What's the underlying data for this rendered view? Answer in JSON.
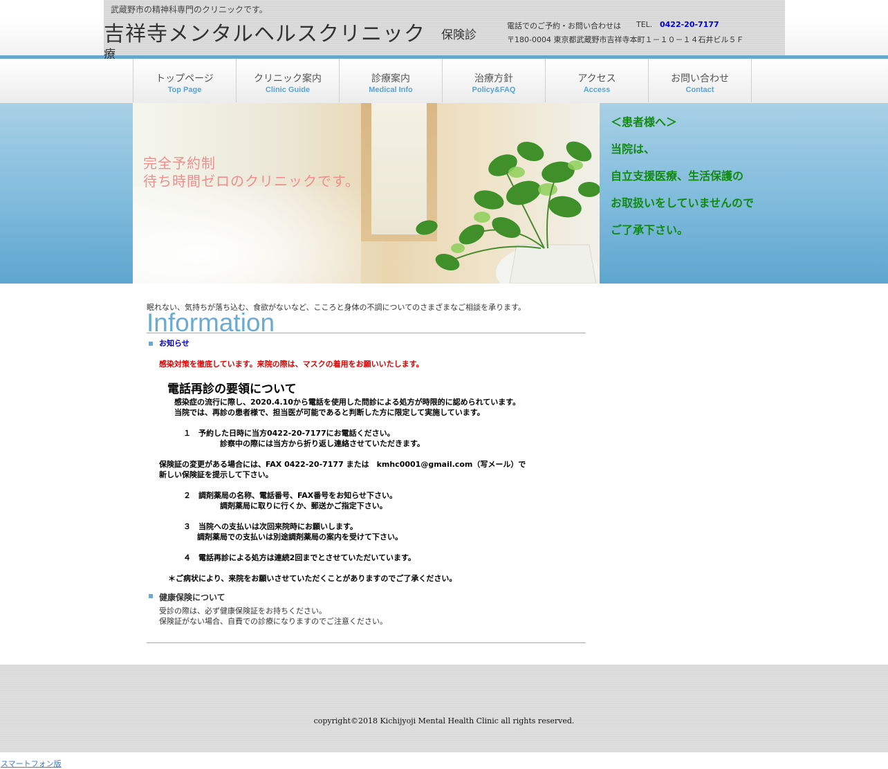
{
  "header": {
    "tagline": "武蔵野市の精神科専門のクリニックです。",
    "site_title": "吉祥寺メンタルヘルスクリニック",
    "insurance_part1": "保険診",
    "insurance_part2": "療",
    "contact_text": "電話でのご予約・お問い合わせは",
    "tel_label": "TEL.",
    "tel_number": "0422-20-7177",
    "address": "〒180-0004 東京都武蔵野市吉祥寺本町１－１０－１４石井ビル５Ｆ"
  },
  "nav": [
    {
      "jp": "トップページ",
      "en": "Top Page"
    },
    {
      "jp": "クリニック案内",
      "en": "Clinic Guide"
    },
    {
      "jp": "診療案内",
      "en": "Medical Info"
    },
    {
      "jp": "治療方針",
      "en": "Policy&FAQ"
    },
    {
      "jp": "アクセス",
      "en": "Access"
    },
    {
      "jp": "お問い合わせ",
      "en": "Contact"
    }
  ],
  "hero": {
    "line1": "完全予約制",
    "line2": "待ち時間ゼロのクリニックです。"
  },
  "notice": [
    "＜患者様へ＞",
    "当院は、",
    "自立支援医療、生活保護の",
    "お取扱いをしていませんので",
    "ご了承下さい。"
  ],
  "main": {
    "intro": "眠れない、気持ちが落ち込む、食欲がないなど、こころと身体の不調についてのさまざまなご相談を承ります。",
    "info_heading": "Information",
    "news_label": "お知らせ",
    "red_notice": "感染対策を徹底しています。来院の際は、マスクの着用をお願いいたします。",
    "phone_title": "電話再診の要領について",
    "phone_line1": "感染症の流行に際し、2020.4.10から電話を使用した問診による処方が時限的に認められています。",
    "phone_line2": "当院では、再診の患者様で、担当医が可能であると判断した方に限定して実施しています。",
    "step1": "１　予約した日時に当方0422-20-7177にお電話ください。",
    "step1_sub": "診察中の際には当方から折り返し連絡させていただきます。",
    "insurance_line1": "保険証の変更がある場合には、FAX 0422-20-7177 または　kmhc0001@gmail.com（写メール）で",
    "insurance_line2": "新しい保険証を提示して下さい。",
    "step2": "２　調剤薬局の名称、電話番号、FAX番号をお知らせ下さい。",
    "step2_sub": "調剤薬局に取りに行くか、郵送かご指定下さい。",
    "step3": "３　当院への支払いは次回来院時にお願いします。",
    "step3_sub": "調剤薬局での支払いは別途調剤薬局の案内を受けて下さい。",
    "step4": "４　電話再診による処方は連続2回までとさせていただいています。",
    "footnote": "＊ご病状により、来院をお願いさせていただくことがありますのでご了承ください。",
    "health_insurance_label": "健康保険について",
    "health_line1": "受診の際は、必ず健康保険証をお持ちください。",
    "health_line2": "保険証がない場合、自費での診療になりますのでご注意ください。"
  },
  "footer": {
    "copyright": "copyright©2018 Kichijyoji Mental Health Clinic all rights reserved.",
    "smartphone_link": "スマートフォン版"
  },
  "colors": {
    "accent_blue": "#66a7cc",
    "nav_en": "#5aa3d3",
    "notice_green": "#118a11",
    "red": "#e00000",
    "tel_blue": "#0000cc",
    "hero_text": "#ee8e8e"
  }
}
